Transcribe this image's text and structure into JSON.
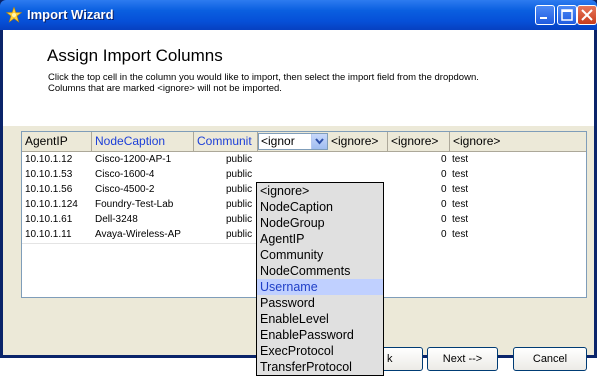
{
  "window": {
    "title": "Import Wizard",
    "icon": "wizard-star-icon",
    "controls": {
      "minimize": "minimize-icon",
      "maximize": "maximize-icon",
      "close": "close-icon"
    }
  },
  "header": {
    "title": "Assign Import Columns",
    "instructions_line1": "Click the top cell in the column you would like to import, then select the import field from the dropdown.",
    "instructions_line2": "Columns that are marked <ignore> will not be imported."
  },
  "grid": {
    "columns": [
      "AgentIP",
      "NodeCaption",
      "Communit",
      "<ignor",
      "<ignore>",
      "<ignore>",
      "<ignore>"
    ],
    "combo_value": "<ignor",
    "rows": [
      {
        "ip": "10.10.1.12",
        "caption": "Cisco-1200-AP-1",
        "community": "public",
        "num": "0",
        "extra": "test"
      },
      {
        "ip": "10.10.1.53",
        "caption": "Cisco-1600-4",
        "community": "public",
        "num": "0",
        "extra": "test"
      },
      {
        "ip": "10.10.1.56",
        "caption": "Cisco-4500-2",
        "community": "public",
        "num": "0",
        "extra": "test"
      },
      {
        "ip": "10.10.1.124",
        "caption": "Foundry-Test-Lab",
        "community": "public",
        "num": "0",
        "extra": "test"
      },
      {
        "ip": "10.10.1.61",
        "caption": "Dell-3248",
        "community": "public",
        "num": "0",
        "extra": "test"
      },
      {
        "ip": "10.10.1.11",
        "caption": "Avaya-Wireless-AP",
        "community": "public",
        "num": "0",
        "extra": "test"
      }
    ]
  },
  "dropdown": {
    "options": [
      "<ignore>",
      "NodeCaption",
      "NodeGroup",
      "AgentIP",
      "Community",
      "NodeComments",
      "Username",
      "Password",
      "EnableLevel",
      "EnablePassword",
      "ExecProtocol",
      "TransferProtocol"
    ],
    "selected_index": 6
  },
  "buttons": {
    "back_partial": "k",
    "next": "Next -->",
    "cancel": "Cancel"
  },
  "colors": {
    "titlebar": "#0a5fe0",
    "link_header": "#1c3fd8",
    "dropdown_highlight": "#c0d0ff",
    "panel_bg": "#ece9d8"
  }
}
